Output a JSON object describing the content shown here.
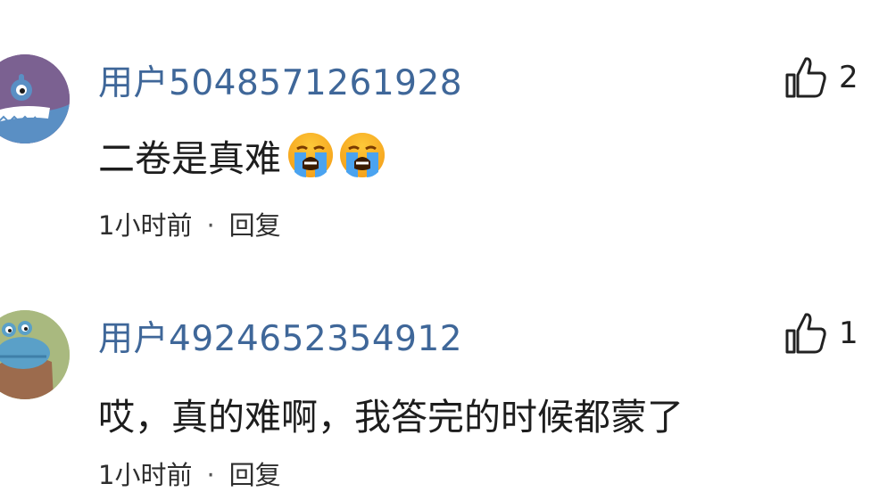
{
  "comments": [
    {
      "username": "用户5048571261928",
      "like_count": "2",
      "content_text": "二卷是真难",
      "emojis": [
        "loudly-crying-face-icon",
        "loudly-crying-face-icon"
      ],
      "time": "1小时前",
      "separator": "·",
      "reply_label": "回复",
      "avatar": "blue-monster-avatar"
    },
    {
      "username": "用户4924652354912",
      "like_count": "1",
      "content_text": "哎，真的难啊，我答完的时候都蒙了",
      "emojis": [],
      "time": "1小时前",
      "separator": "·",
      "reply_label": "回复",
      "avatar": "blue-creature-avatar"
    }
  ],
  "colors": {
    "username": "#3f6799",
    "text": "#1d1d1d",
    "avatar1_bg": "#7b6191",
    "avatar2_bg": "#a9b97f"
  }
}
